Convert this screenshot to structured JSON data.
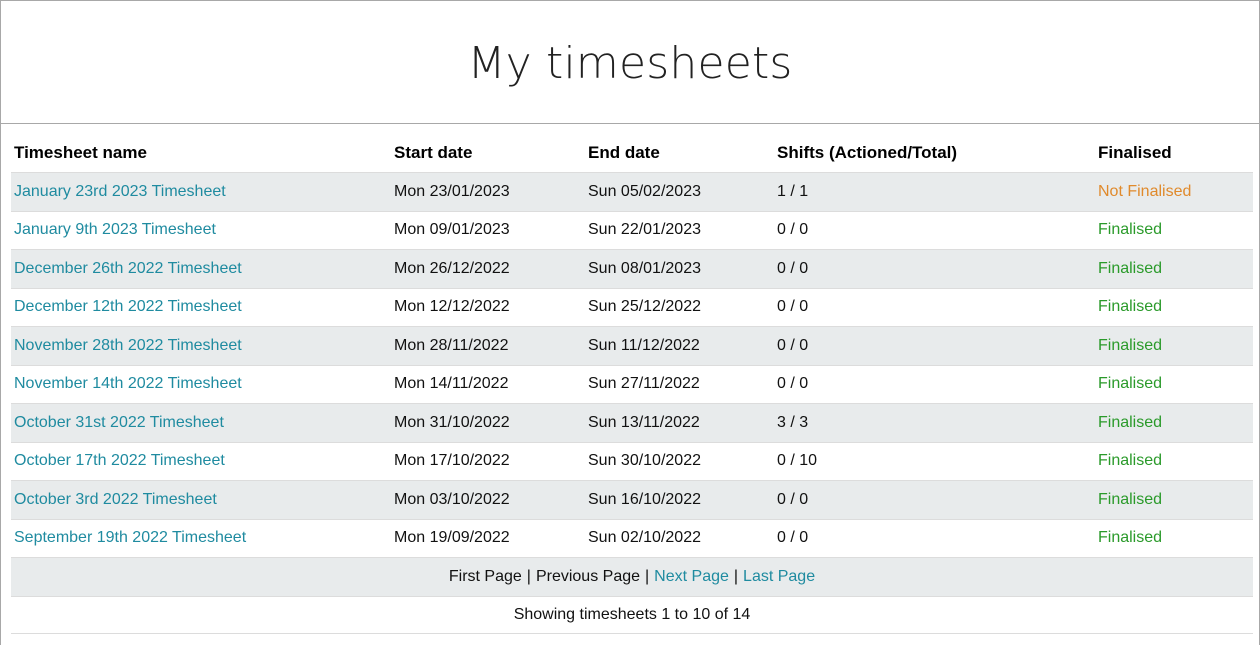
{
  "page": {
    "title": "My timesheets"
  },
  "table": {
    "headers": [
      "Timesheet name",
      "Start date",
      "End date",
      "Shifts (Actioned/Total)",
      "Finalised"
    ],
    "rows": [
      {
        "name": "January 23rd 2023 Timesheet",
        "start": "Mon 23/01/2023",
        "end": "Sun 05/02/2023",
        "shifts": "1 / 1",
        "status": "Not Finalised"
      },
      {
        "name": "January 9th 2023 Timesheet",
        "start": "Mon 09/01/2023",
        "end": "Sun 22/01/2023",
        "shifts": "0 / 0",
        "status": "Finalised"
      },
      {
        "name": "December 26th 2022 Timesheet",
        "start": "Mon 26/12/2022",
        "end": "Sun 08/01/2023",
        "shifts": "0 / 0",
        "status": "Finalised"
      },
      {
        "name": "December 12th 2022 Timesheet",
        "start": "Mon 12/12/2022",
        "end": "Sun 25/12/2022",
        "shifts": "0 / 0",
        "status": "Finalised"
      },
      {
        "name": "November 28th 2022 Timesheet",
        "start": "Mon 28/11/2022",
        "end": "Sun 11/12/2022",
        "shifts": "0 / 0",
        "status": "Finalised"
      },
      {
        "name": "November 14th 2022 Timesheet",
        "start": "Mon 14/11/2022",
        "end": "Sun 27/11/2022",
        "shifts": "0 / 0",
        "status": "Finalised"
      },
      {
        "name": "October 31st 2022 Timesheet",
        "start": "Mon 31/10/2022",
        "end": "Sun 13/11/2022",
        "shifts": "3 / 3",
        "status": "Finalised"
      },
      {
        "name": "October 17th 2022 Timesheet",
        "start": "Mon 17/10/2022",
        "end": "Sun 30/10/2022",
        "shifts": "0 / 10",
        "status": "Finalised"
      },
      {
        "name": "October 3rd 2022 Timesheet",
        "start": "Mon 03/10/2022",
        "end": "Sun 16/10/2022",
        "shifts": "0 / 0",
        "status": "Finalised"
      },
      {
        "name": "September 19th 2022 Timesheet",
        "start": "Mon 19/09/2022",
        "end": "Sun 02/10/2022",
        "shifts": "0 / 0",
        "status": "Finalised"
      }
    ]
  },
  "pagination": {
    "first": "First Page",
    "previous": "Previous Page",
    "next": "Next Page",
    "last": "Last Page",
    "separator": "|"
  },
  "summary": "Showing timesheets 1 to 10 of 14",
  "colors": {
    "link": "#1f8ba0",
    "finalised": "#2a9a2a",
    "not_finalised": "#e08a2c",
    "row_shade": "#e8ebec"
  }
}
